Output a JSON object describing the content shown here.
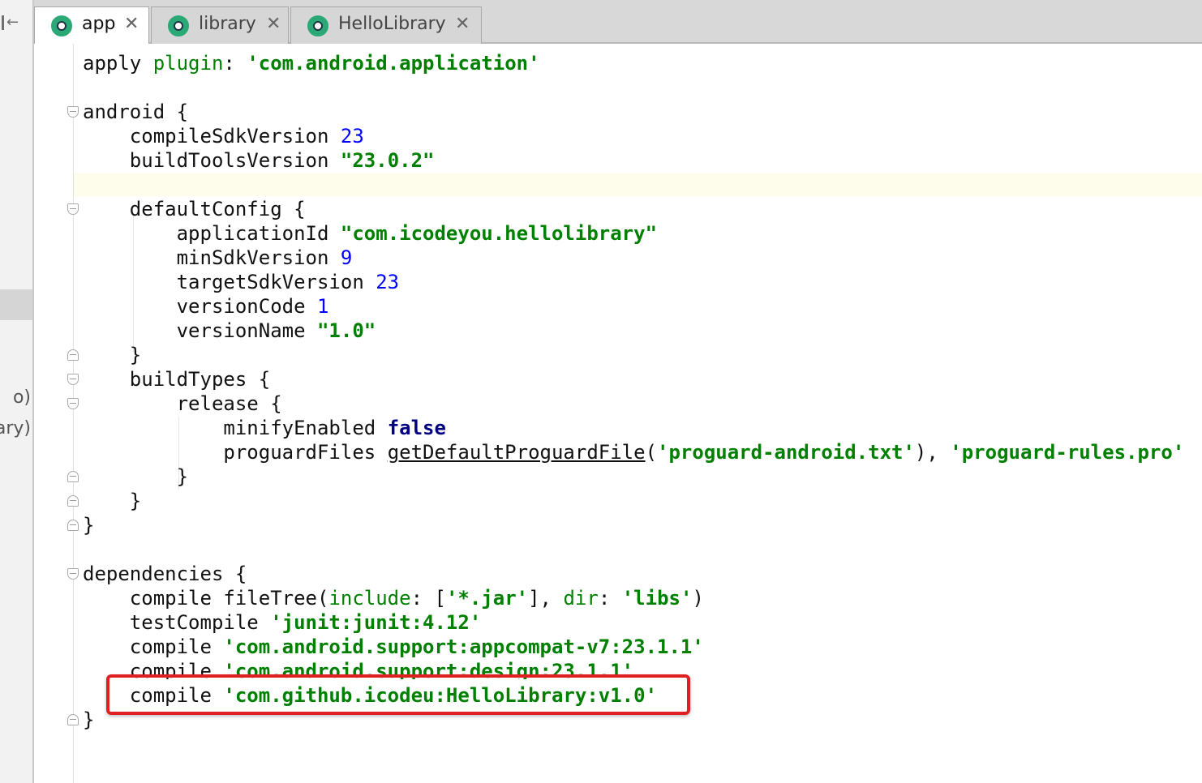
{
  "left_panel": {
    "fragment_1": "o)",
    "fragment_2": "ary)"
  },
  "tabs": [
    {
      "label": "app",
      "active": true
    },
    {
      "label": "library",
      "active": false
    },
    {
      "label": "HelloLibrary",
      "active": false
    }
  ],
  "tab_close_glyph": "✕",
  "code": {
    "line1": {
      "a": "apply ",
      "b": "plugin",
      "c": ": ",
      "d": "'com.android.application'"
    },
    "line3": "android {",
    "line4": {
      "a": "    compileSdkVersion ",
      "b": "23"
    },
    "line5": {
      "a": "    buildToolsVersion ",
      "b": "\"23.0.2\""
    },
    "line7": "    defaultConfig {",
    "line8": {
      "a": "        applicationId ",
      "b": "\"com.icodeyou.hellolibrary\""
    },
    "line9": {
      "a": "        minSdkVersion ",
      "b": "9"
    },
    "line10": {
      "a": "        targetSdkVersion ",
      "b": "23"
    },
    "line11": {
      "a": "        versionCode ",
      "b": "1"
    },
    "line12": {
      "a": "        versionName ",
      "b": "\"1.0\""
    },
    "line13": "    }",
    "line14": "    buildTypes {",
    "line15": "        release {",
    "line16": {
      "a": "            minifyEnabled ",
      "b": "false"
    },
    "line17": {
      "a": "            proguardFiles ",
      "b": "getDefaultProguardFile",
      "c": "(",
      "d": "'proguard-android.txt'",
      "e": "), ",
      "f": "'proguard-rules.pro'"
    },
    "line18": "        }",
    "line19": "    }",
    "line20": "}",
    "line22": "dependencies {",
    "line23": {
      "a": "    compile fileTree(",
      "b": "include",
      "c": ": [",
      "d": "'*.jar'",
      "e": "], ",
      "f": "dir",
      "g": ": ",
      "h": "'libs'",
      "i": ")"
    },
    "line24": {
      "a": "    testCompile ",
      "b": "'junit:junit:4.12'"
    },
    "line25": {
      "a": "    compile ",
      "b": "'com.android.support:appcompat-v7:23.1.1'"
    },
    "line26": {
      "a": "    compile ",
      "b": "'com.android.support:design:23.1.1'"
    },
    "line27": {
      "a": "    compile ",
      "b": "'com.github.icodeu:HelloLibrary:v1.0'"
    },
    "line28": "}"
  },
  "colors": {
    "string": "#008000",
    "number": "#0000ff",
    "keyword": "#000080",
    "callout": "#e02020",
    "caret_row": "#fefcea"
  }
}
